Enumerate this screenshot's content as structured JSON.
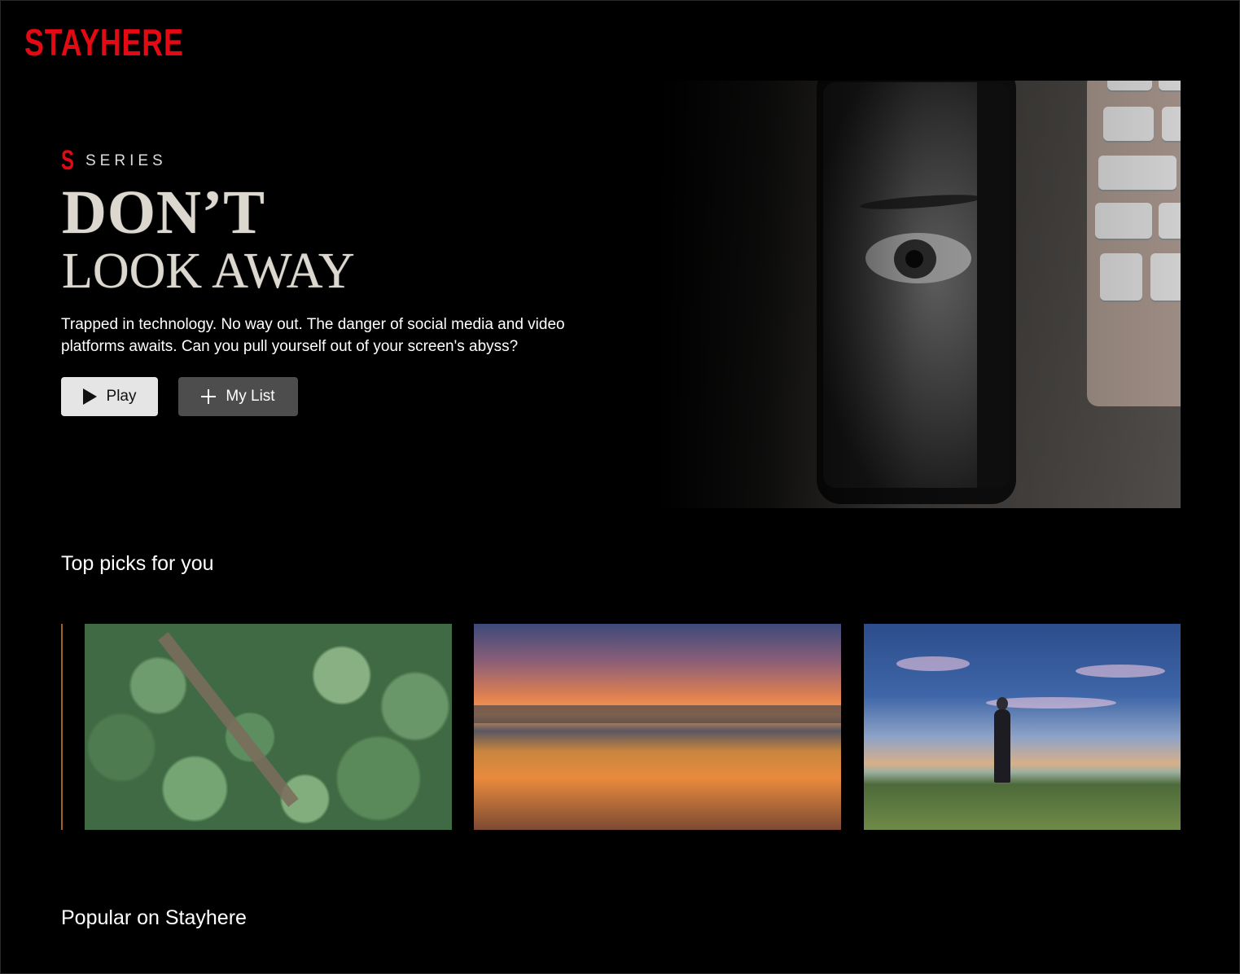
{
  "brand": {
    "logo_text": "STAYHERE",
    "accent_color": "#e50914"
  },
  "hero": {
    "badge_letter": "S",
    "badge_label": "SERIES",
    "title_line_1": "DON’T",
    "title_line_2": "LOOK AWAY",
    "synopsis": "Trapped in technology. No way out. The danger of social media and video platforms awaits. Can you pull yourself out of your screen's abyss?",
    "play_label": "Play",
    "my_list_label": "My List",
    "image_icon": "phone-with-eye-image"
  },
  "rows": [
    {
      "title": "Top picks for you",
      "items": [
        {
          "icon": "forest-aerial-image"
        },
        {
          "icon": "beach-sunset-image"
        },
        {
          "icon": "person-in-field-image"
        }
      ]
    },
    {
      "title": "Popular on Stayhere",
      "items": []
    }
  ]
}
